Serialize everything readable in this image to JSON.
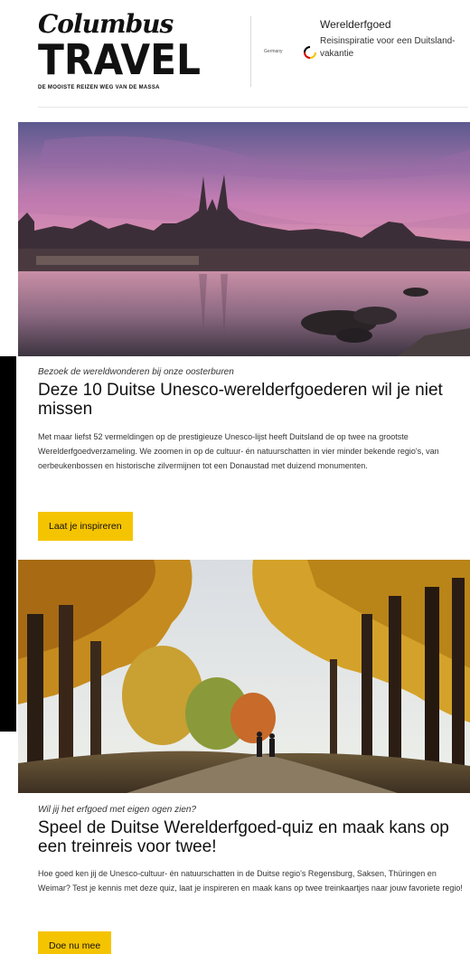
{
  "brand": {
    "logo_script": "Columbus",
    "logo_main": "TRAVEL",
    "tagline": "DE MOOISTE REIZEN WEG VAN DE MASSA"
  },
  "header": {
    "partner_label": "Germany",
    "title": "Werelderfgoed",
    "subtitle": "Reisinspiratie voor een Duitsland-vakantie"
  },
  "articles": [
    {
      "kicker": "Bezoek de wereldwonderen bij onze oosterburen",
      "headline": "Deze 10 Duitse Unesco-werelderfgoederen wil je niet missen",
      "body": "Met maar liefst 52 vermeldingen op de prestigieuze Unesco-lijst heeft Duitsland de op twee na grootste Werelderfgoedverzameling. We zoomen in op de cultuur- én natuurschatten in vier minder bekende regio's, van oerbeukenbossen en historische zilvermijnen tot een Donaustad met duizend monumenten.",
      "cta": "Laat je inspireren"
    },
    {
      "kicker": "Wil jij het erfgoed met eigen ogen zien?",
      "headline": "Speel de Duitse Werelderfgoed-quiz en maak kans op een treinreis voor twee!",
      "body": "Hoe goed ken jij de Unesco-cultuur- én natuurschatten in de Duitse regio's Regensburg, Saksen, Thüringen en Weimar? Test je kennis met deze quiz, laat je inspireren en maak kans op twee treinkaartjes naar jouw favoriete regio!",
      "cta": "Doe nu mee"
    }
  ],
  "colors": {
    "cta_background": "#f5c400",
    "text": "#111111"
  }
}
